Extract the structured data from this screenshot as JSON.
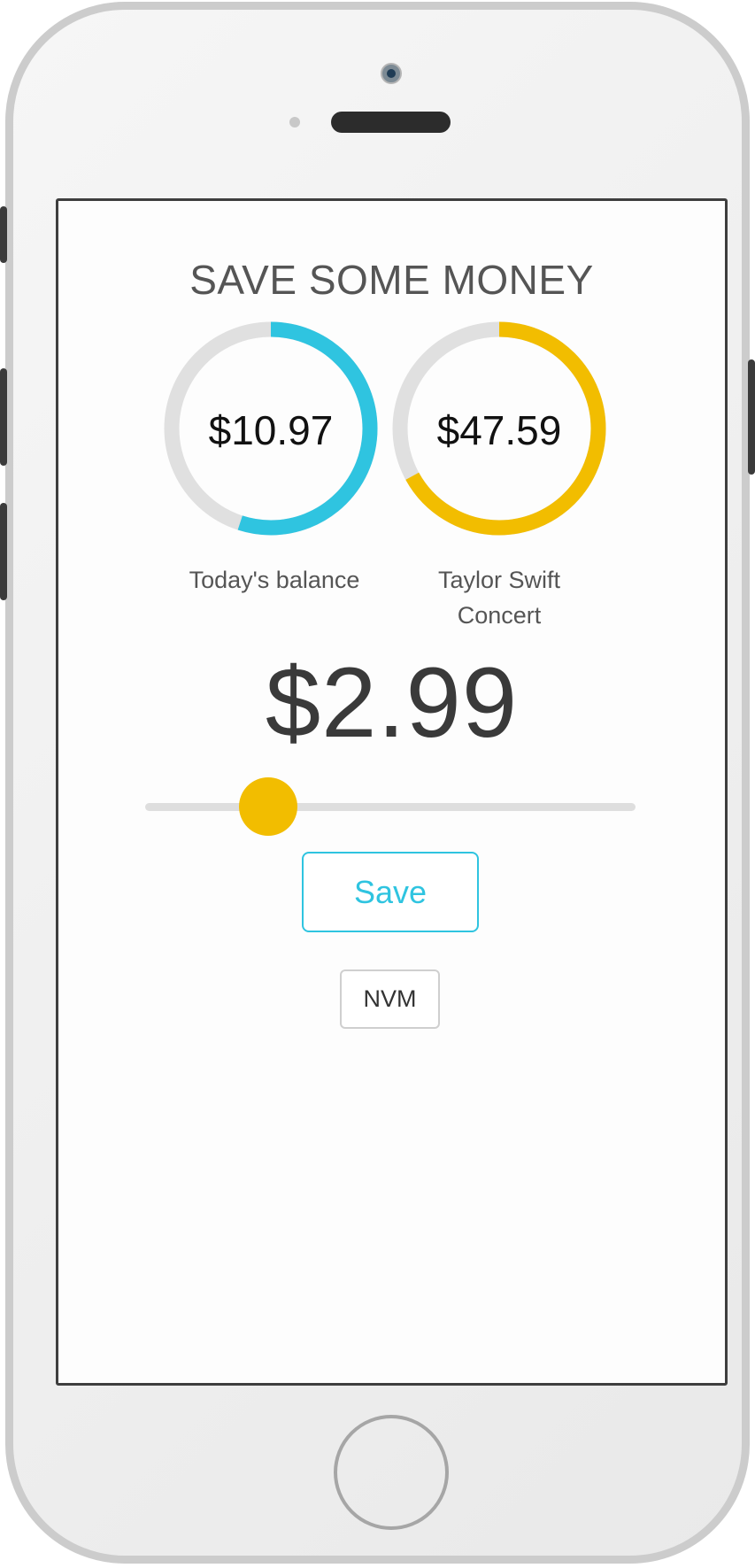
{
  "header": {
    "title": "SAVE SOME MONEY"
  },
  "rings": [
    {
      "value": "$10.97",
      "label": "Today's balance",
      "progress": 0.55,
      "color": "#2fc4e0"
    },
    {
      "value": "$47.59",
      "label": "Taylor Swift Concert",
      "progress": 0.67,
      "color": "#f2bd00"
    }
  ],
  "amount": {
    "value": "$2.99"
  },
  "slider": {
    "level": 0.25,
    "color": "#f2bd00"
  },
  "actions": {
    "save_label": "Save",
    "nvm_label": "NVM"
  },
  "colors": {
    "accent": "#2fc4e0",
    "highlight": "#f2bd00",
    "track": "#dedede"
  }
}
